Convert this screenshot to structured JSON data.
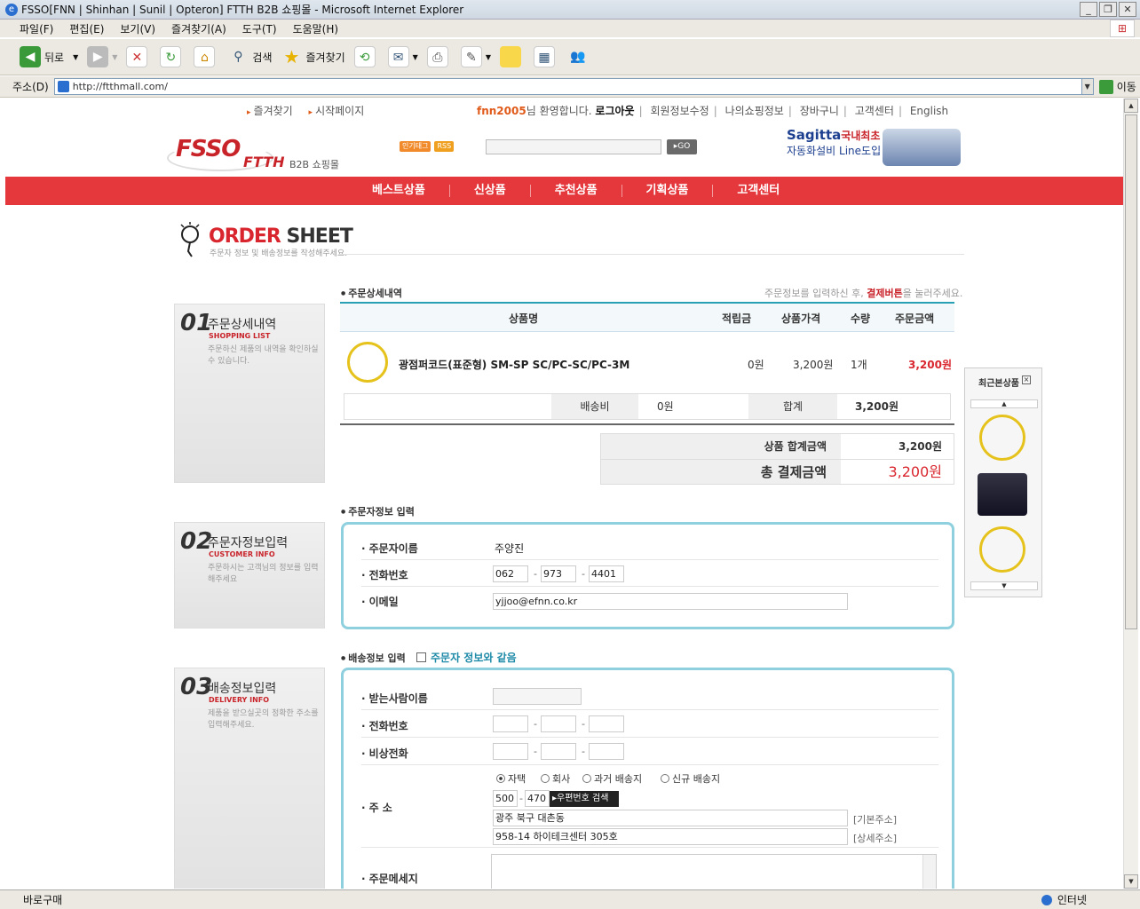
{
  "window": {
    "title": "FSSO[FNN | Shinhan | Sunil | Opteron] FTTH B2B 쇼핑몰 - Microsoft Internet Explorer"
  },
  "menu": [
    "파일(F)",
    "편집(E)",
    "보기(V)",
    "즐겨찾기(A)",
    "도구(T)",
    "도움말(H)"
  ],
  "toolbar": {
    "back": "뒤로",
    "search": "검색",
    "favorites": "즐겨찾기"
  },
  "address": {
    "label": "주소(D)",
    "url": "http://ftthmall.com/",
    "go": "이동"
  },
  "status": {
    "text": "바로구매",
    "zone": "인터넷"
  },
  "top_links": [
    "즐겨찾기",
    "시작페이지"
  ],
  "user": {
    "id": "fnn2005",
    "welcome": "님 환영합니다.",
    "logout": "로그아웃",
    "links": [
      "회원정보수정",
      "나의쇼핑정보",
      "장바구니",
      "고객센터",
      "English"
    ]
  },
  "logo": {
    "fsso": "FSSO",
    "ftth": "FTTH",
    "b2b": "B2B 쇼핑몰"
  },
  "search": {
    "tag1": "인기태그",
    "tag2": "RSS",
    "go": "GO"
  },
  "banner": {
    "line1": "Sagitta",
    "line1b": "국내최초",
    "line2": "자동화설비 Line도입"
  },
  "nav": [
    "베스트상품",
    "신상품",
    "추천상품",
    "기획상품",
    "고객센터"
  ],
  "order_sheet": {
    "title_a": "ORDER",
    "title_b": "SHEET",
    "subtitle": "주문자 정보 및 배송정보를 작성해주세요."
  },
  "sections": [
    {
      "num": "01",
      "title": "주문상세내역",
      "en": "SHOPPING LIST",
      "desc": "주문하신 제품의 내역을 확인하실 수 있습니다."
    },
    {
      "num": "02",
      "title": "주문자정보입력",
      "en": "CUSTOMER INFO",
      "desc": "주문하시는 고객님의 정보를 입력해주세요"
    },
    {
      "num": "03",
      "title": "배송정보입력",
      "en": "DELIVERY INFO",
      "desc": "제품을 받으실곳의 정확한 주소를 입력해주세요."
    }
  ],
  "order_detail": {
    "heading": "주문상세내역",
    "hint_a": "주문정보를 입력하신 후,",
    "hint_b": "결제버튼",
    "hint_c": "을 눌러주세요.",
    "columns": [
      "상품명",
      "적립금",
      "상품가격",
      "수량",
      "주문금액"
    ],
    "item": {
      "name": "광점퍼코드(표준형) SM-SP SC/PC-SC/PC-3M",
      "points": "0원",
      "price": "3,200원",
      "qty": "1개",
      "amount": "3,200원"
    },
    "shipping_label": "배송비",
    "shipping_value": "0원",
    "sum_label": "합계",
    "sum_value": "3,200원",
    "product_total_label": "상품 합계금액",
    "product_total_value": "3,200원",
    "grand_total_label": "총 결제금액",
    "grand_total_value": "3,200원"
  },
  "customer": {
    "heading": "주문자정보 입력",
    "name_label": "주문자이름",
    "name": "주양진",
    "phone_label": "전화번호",
    "phone": [
      "062",
      "973",
      "4401"
    ],
    "email_label": "이메일",
    "email": "yjjoo@efnn.co.kr"
  },
  "delivery": {
    "heading": "배송정보 입력",
    "same_label": "주문자 정보와 같음",
    "recipient_label": "받는사람이름",
    "phone_label": "전화번호",
    "emergency_label": "비상전화",
    "address_label": "주 소",
    "radio": [
      "자택",
      "회사",
      "과거 배송지",
      "신규 배송지"
    ],
    "zip": [
      "500",
      "470"
    ],
    "zip_button": "우편번호 검색",
    "addr1": "광주 북구 대촌동",
    "addr1_note": "[기본주소]",
    "addr2": "958-14 하이테크센터 305호",
    "addr2_note": "[상세주소]",
    "message_label": "주문메세지"
  },
  "recent": {
    "title": "최근본상품"
  },
  "colors": {
    "nav_red": "#e5383d",
    "accent_teal": "#2aa0b5",
    "price_red": "#d9262e"
  }
}
